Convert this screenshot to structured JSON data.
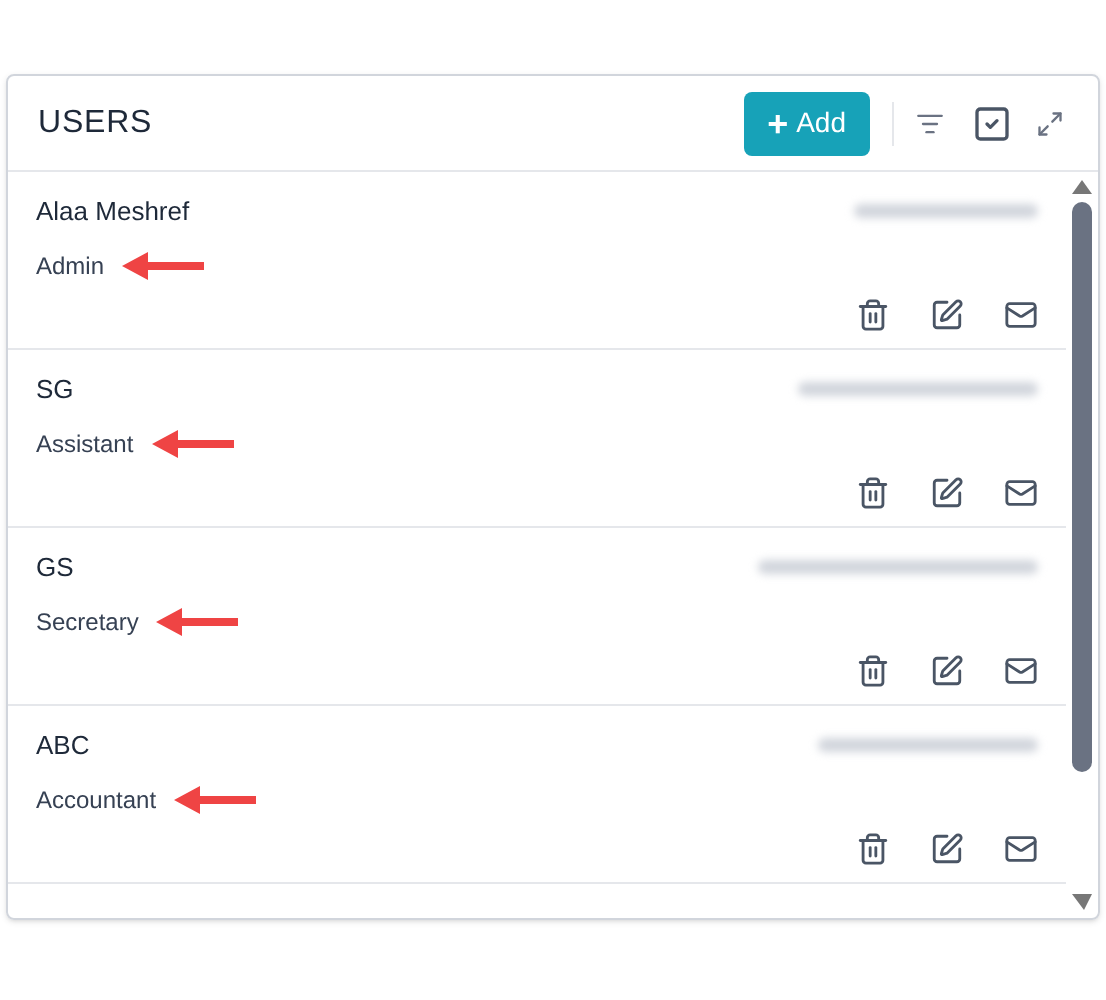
{
  "panel": {
    "title": "USERS",
    "add_button": "Add",
    "add_icon": "+"
  },
  "users": [
    {
      "name": "Alaa Meshref",
      "role": "Admin",
      "highlighted": true
    },
    {
      "name": "SG",
      "role": "Assistant",
      "highlighted": true
    },
    {
      "name": "GS",
      "role": "Secretary",
      "highlighted": true
    },
    {
      "name": "ABC",
      "role": "Accountant",
      "highlighted": true
    }
  ]
}
